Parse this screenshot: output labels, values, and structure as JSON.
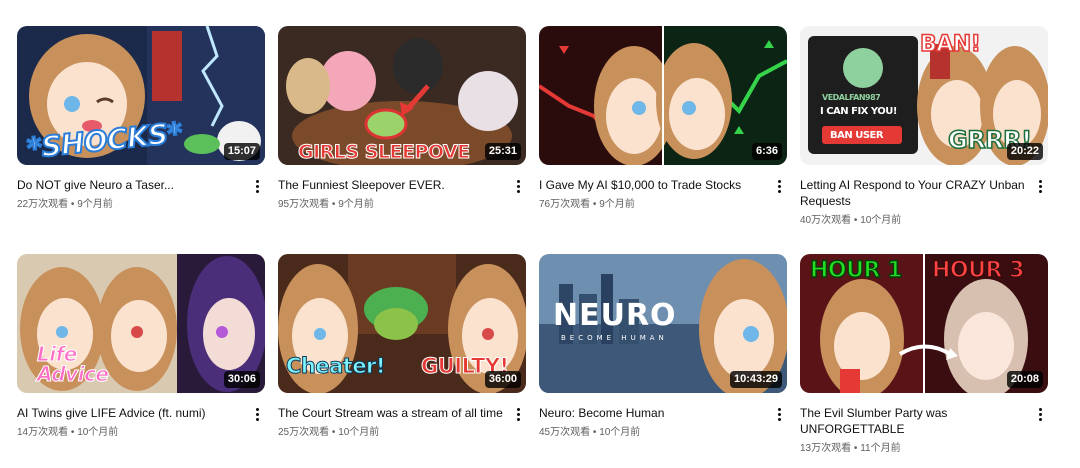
{
  "videos": [
    {
      "title": "Do NOT give Neuro a Taser...",
      "views": "22万次观看",
      "age": "9个月前",
      "duration": "15:07",
      "overlay": "*SHOCKS*",
      "overlay_color": "#ffffff"
    },
    {
      "title": "The Funniest Sleepover EVER.",
      "views": "95万次观看",
      "age": "9个月前",
      "duration": "25:31",
      "overlay": "GIRLS SLEEPOVE",
      "overlay_color": "#e53935"
    },
    {
      "title": "I Gave My AI $10,000 to Trade Stocks",
      "views": "76万次观看",
      "age": "9个月前",
      "duration": "6:36",
      "overlay": "",
      "overlay_color": "#ffffff"
    },
    {
      "title": "Letting AI Respond to Your CRAZY Unban Requests",
      "views": "40万次观看",
      "age": "10个月前",
      "duration": "20:22",
      "overlay": "GRRR!",
      "overlay_color": "#ffffff",
      "extra": {
        "ban": "BAN!",
        "username": "VEDALFAN987",
        "fix": "I CAN FIX YOU!",
        "ban_user": "BAN USER"
      }
    },
    {
      "title": "AI Twins give LIFE Advice (ft. numi)",
      "views": "14万次观看",
      "age": "10个月前",
      "duration": "30:06",
      "overlay": "Life Advice",
      "overlay_color": "#ff6ec7"
    },
    {
      "title": "The Court Stream was a stream of all time",
      "views": "25万次观看",
      "age": "10个月前",
      "duration": "36:00",
      "overlay": "Cheater!",
      "overlay_color": "#7ff3ff",
      "overlay2": "GUILTY!"
    },
    {
      "title": "Neuro: Become Human",
      "views": "45万次观看",
      "age": "10个月前",
      "duration": "10:43:29",
      "overlay": "NEURO",
      "overlay_color": "#ffffff",
      "overlay2": "BECOME HUMAN"
    },
    {
      "title": "The Evil Slumber Party was UNFORGETTABLE",
      "views": "13万次观看",
      "age": "11个月前",
      "duration": "20:08",
      "overlay": "HOUR 1",
      "overlay_color": "#22dd22",
      "overlay2": "HOUR 3"
    }
  ],
  "separator": " • "
}
